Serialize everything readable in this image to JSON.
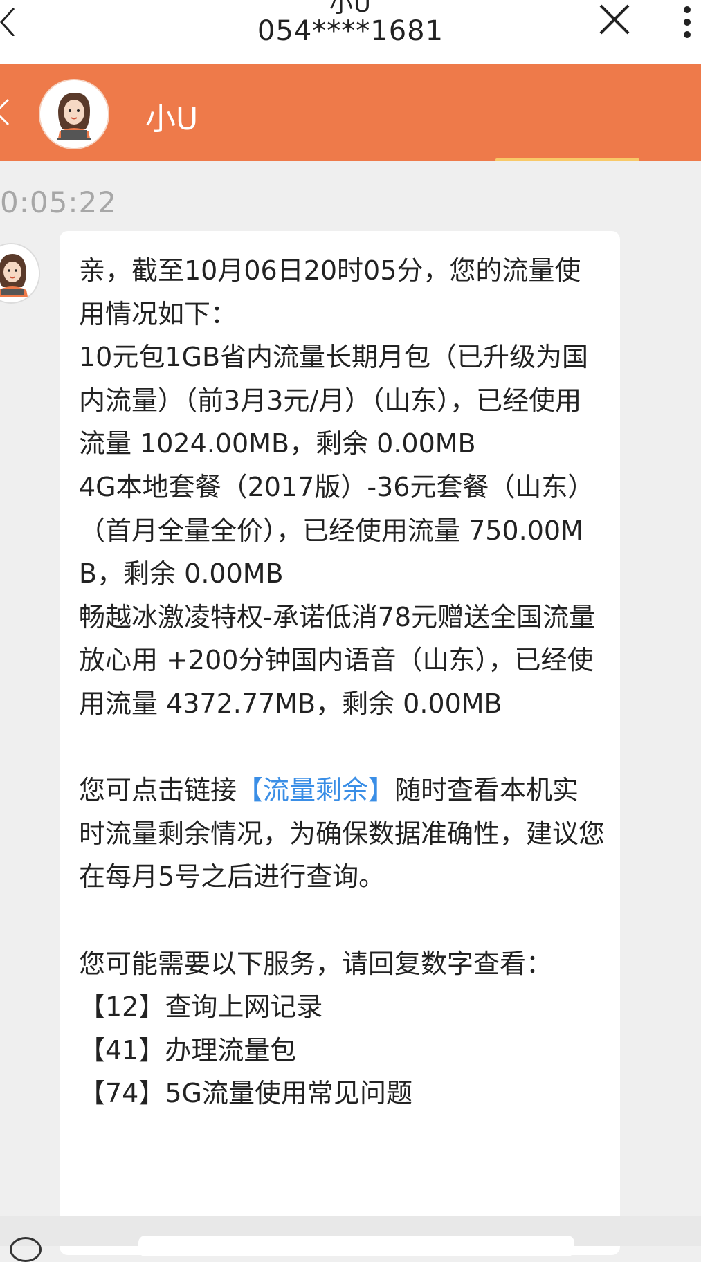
{
  "topbar": {
    "title": "小U",
    "subtitle": "054****1681",
    "icons": [
      "back-icon",
      "close-icon",
      "more-icon"
    ]
  },
  "chat_header": {
    "name": "小U",
    "accent": "#ee7a4a"
  },
  "message": {
    "time": "0:05:22",
    "para1": "亲，截至10月06日20时05分，您的流量使用情况如下：",
    "item1": "10元包1GB省内流量长期月包（已升级为国内流量）（前3月3元/月）（山东），已经使用流量 1024.00MB，剩余 0.00MB",
    "item2": "4G本地套餐（2017版）-36元套餐（山东）（首月全量全价），已经使用流量 750.00MB，剩余 0.00MB",
    "item3": "畅越冰激凌特权-承诺低消78元赠送全国流量放心用 +200分钟国内语音（山东），已经使用流量 4372.77MB，剩余 0.00MB",
    "para2_pre": "您可点击链接",
    "para2_link": "【流量剩余】",
    "para2_post": "随时查看本机实时流量剩余情况，为确保数据准确性，建议您在每月5号之后进行查询。",
    "para3": "您可能需要以下服务，请回复数字查看：",
    "options": [
      "【12】查询上网记录",
      "【41】办理流量包",
      "【74】5G流量使用常见问题"
    ]
  },
  "colors": {
    "header": "#ee7a4a",
    "link": "#3a8ee6",
    "background": "#efefef",
    "bubble": "#ffffff"
  }
}
